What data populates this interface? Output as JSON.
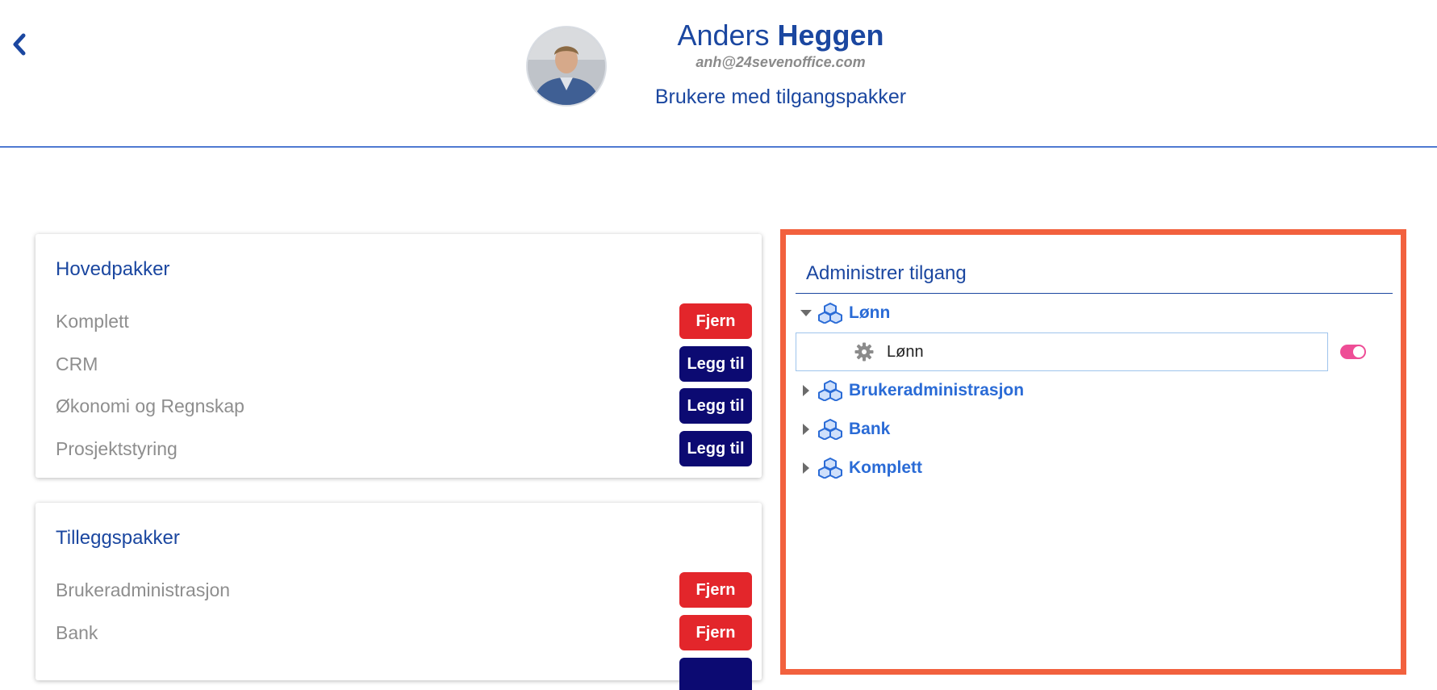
{
  "header": {
    "first_name": "Anders",
    "last_name": "Heggen",
    "email": "anh@24sevenoffice.com",
    "subtitle": "Brukere med tilgangspakker"
  },
  "main_packages": {
    "title": "Hovedpakker",
    "items": [
      {
        "label": "Komplett",
        "action": "Fjern"
      },
      {
        "label": "CRM",
        "action": "Legg til"
      },
      {
        "label": "Økonomi og Regnskap",
        "action": "Legg til"
      },
      {
        "label": "Prosjektstyring",
        "action": "Legg til"
      }
    ]
  },
  "addon_packages": {
    "title": "Tilleggspakker",
    "items": [
      {
        "label": "Brukeradministrasjon",
        "action": "Fjern"
      },
      {
        "label": "Bank",
        "action": "Fjern"
      }
    ]
  },
  "access_admin": {
    "title": "Administrer tilgang",
    "tree": [
      {
        "label": "Lønn",
        "expanded": true,
        "children": [
          {
            "label": "Lønn",
            "enabled": true
          }
        ]
      },
      {
        "label": "Brukeradministrasjon",
        "expanded": false
      },
      {
        "label": "Bank",
        "expanded": false
      },
      {
        "label": "Komplett",
        "expanded": false
      }
    ]
  },
  "colors": {
    "brand_blue": "#1b47a0",
    "link_blue": "#2a6bd6",
    "remove_red": "#e3262b",
    "add_navy": "#0c0a72",
    "highlight_border": "#f2613e",
    "toggle_on": "#ee4d96"
  },
  "icons": {
    "back": "chevron-left-icon",
    "package": "cubes-icon",
    "permission": "gear-icon",
    "expand": "caret-right-icon",
    "collapse": "caret-down-icon"
  }
}
